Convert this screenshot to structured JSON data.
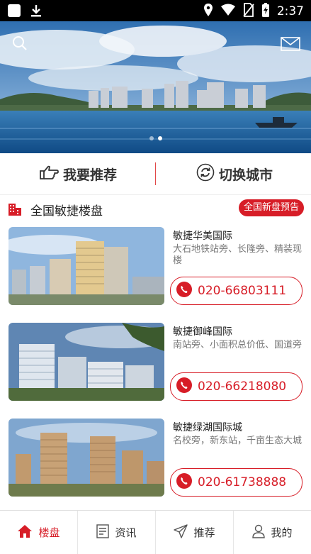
{
  "status_bar": {
    "time": "2:37"
  },
  "actions": {
    "recommend_label": "我要推荐",
    "switch_city_label": "切换城市"
  },
  "section": {
    "title": "全国敏捷楼盘",
    "badge": "全国新盘预告"
  },
  "properties": [
    {
      "name": "敏捷华美国际",
      "desc": "大石地铁站旁、长隆旁、精装现楼",
      "phone": "020-66803111"
    },
    {
      "name": "敏捷御峰国际",
      "desc": "南站旁、小面积总价低、国道旁",
      "phone": "020-66218080"
    },
    {
      "name": "敏捷绿湖国际城",
      "desc": "名校旁，新东站，千亩生态大城",
      "phone": "020-61738888"
    }
  ],
  "tabs": [
    {
      "label": "楼盘",
      "icon": "home-icon",
      "active": true
    },
    {
      "label": "资讯",
      "icon": "document-icon",
      "active": false
    },
    {
      "label": "推荐",
      "icon": "send-icon",
      "active": false
    },
    {
      "label": "我的",
      "icon": "user-icon",
      "active": false
    }
  ],
  "banner": {
    "slides": 2,
    "active_slide": 2
  },
  "colors": {
    "accent": "#d71d27",
    "text": "#222222",
    "muted": "#777777"
  }
}
